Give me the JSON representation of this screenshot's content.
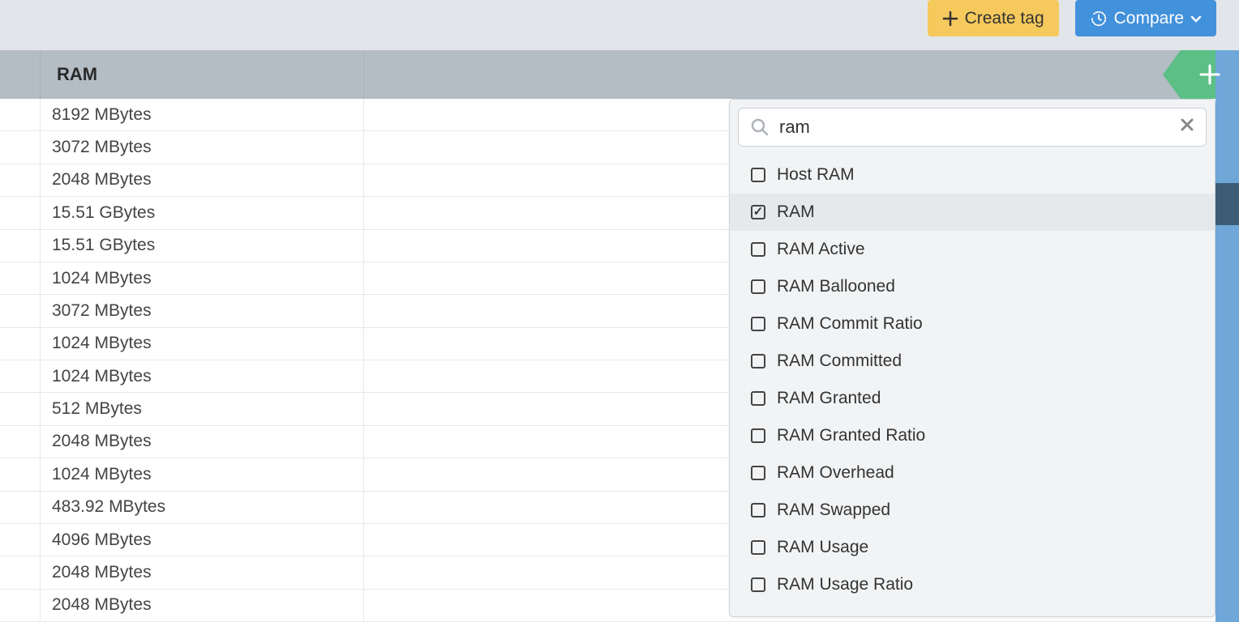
{
  "toolbar": {
    "create_tag_label": "Create tag",
    "compare_label": "Compare"
  },
  "column": {
    "header": "RAM"
  },
  "rows": [
    "8192 MBytes",
    "3072 MBytes",
    "2048 MBytes",
    "15.51 GBytes",
    "15.51 GBytes",
    "1024 MBytes",
    "3072 MBytes",
    "1024 MBytes",
    "1024 MBytes",
    "512 MBytes",
    "2048 MBytes",
    "1024 MBytes",
    "483.92 MBytes",
    "4096 MBytes",
    "2048 MBytes",
    "2048 MBytes"
  ],
  "filter": {
    "search_value": "ram",
    "options": [
      {
        "label": "Host RAM",
        "checked": false
      },
      {
        "label": "RAM",
        "checked": true
      },
      {
        "label": "RAM Active",
        "checked": false
      },
      {
        "label": "RAM Ballooned",
        "checked": false
      },
      {
        "label": "RAM Commit Ratio",
        "checked": false
      },
      {
        "label": "RAM Committed",
        "checked": false
      },
      {
        "label": "RAM Granted",
        "checked": false
      },
      {
        "label": "RAM Granted Ratio",
        "checked": false
      },
      {
        "label": "RAM Overhead",
        "checked": false
      },
      {
        "label": "RAM Swapped",
        "checked": false
      },
      {
        "label": "RAM Usage",
        "checked": false
      },
      {
        "label": "RAM Usage Ratio",
        "checked": false
      }
    ]
  }
}
